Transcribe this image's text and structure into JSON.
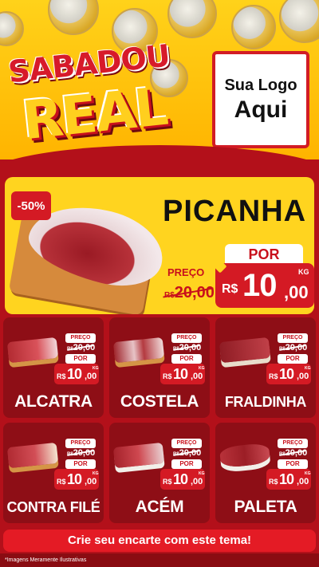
{
  "header": {
    "title_line1": "SABADOU",
    "title_line2": "REAL",
    "logo_line1": "Sua Logo",
    "logo_line2": "Aqui"
  },
  "featured": {
    "discount": "-50%",
    "name": "PICANHA",
    "preco_label": "PREÇO",
    "old_currency": "R$",
    "old_value": "20,00",
    "por_label": "POR",
    "currency": "R$",
    "price_int": "10",
    "price_dec": ",00",
    "unit": "KG"
  },
  "products": [
    {
      "name": "ALCATRA",
      "preco_label": "PREÇO",
      "old_currency": "R$",
      "old_value": "20,00",
      "por_label": "POR",
      "currency": "R$",
      "price_int": "10",
      "price_dec": ",00",
      "unit": "KG"
    },
    {
      "name": "COSTELA",
      "preco_label": "PREÇO",
      "old_currency": "R$",
      "old_value": "20,00",
      "por_label": "POR",
      "currency": "R$",
      "price_int": "10",
      "price_dec": ",00",
      "unit": "KG"
    },
    {
      "name": "FRALDINHA",
      "preco_label": "PREÇO",
      "old_currency": "R$",
      "old_value": "20,00",
      "por_label": "POR",
      "currency": "R$",
      "price_int": "10",
      "price_dec": ",00",
      "unit": "KG"
    },
    {
      "name": "CONTRA FILÉ",
      "preco_label": "PREÇO",
      "old_currency": "R$",
      "old_value": "20,00",
      "por_label": "POR",
      "currency": "R$",
      "price_int": "10",
      "price_dec": ",00",
      "unit": "KG"
    },
    {
      "name": "ACÉM",
      "preco_label": "PREÇO",
      "old_currency": "R$",
      "old_value": "20,00",
      "por_label": "POR",
      "currency": "R$",
      "price_int": "10",
      "price_dec": ",00",
      "unit": "KG"
    },
    {
      "name": "PALETA",
      "preco_label": "PREÇO",
      "old_currency": "R$",
      "old_value": "20,00",
      "por_label": "POR",
      "currency": "R$",
      "price_int": "10",
      "price_dec": ",00",
      "unit": "KG"
    }
  ],
  "footer": {
    "cta": "Crie seu encarte com este tema!",
    "disclaimer": "*Imagens Meramente Ilustrativas"
  },
  "colors": {
    "header_yellow": "#ffd21a",
    "brand_red": "#d41a24",
    "dark_red": "#8e0e16",
    "background": "#b3101a"
  }
}
